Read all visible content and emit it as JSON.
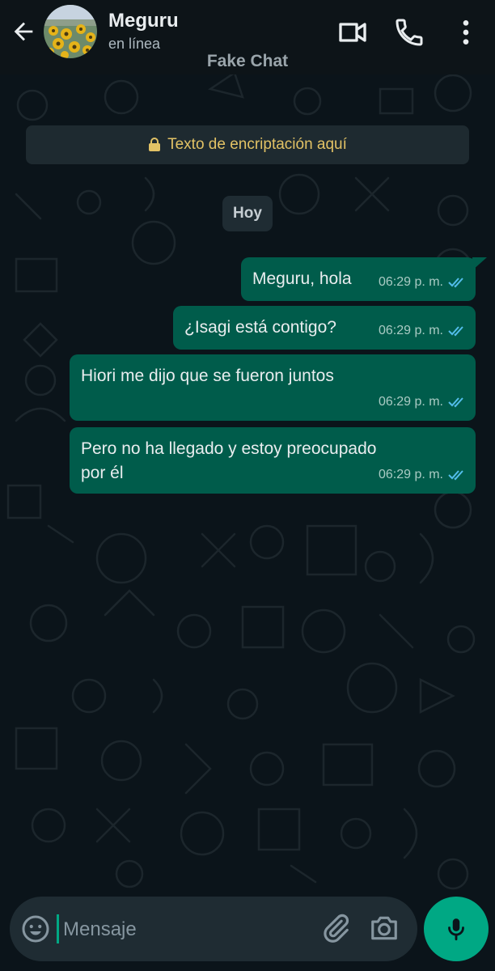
{
  "header": {
    "contact_name": "Meguru",
    "status": "en línea",
    "watermark": "Fake Chat",
    "icons": [
      "arrow-left-icon",
      "video-call-icon",
      "phone-icon",
      "more-vert-icon"
    ]
  },
  "chat": {
    "encryption_notice": "Texto de encriptación aquí",
    "date_label": "Hoy",
    "messages": [
      {
        "text": "Meguru, hola",
        "time": "06:29 p. m.",
        "status": "read"
      },
      {
        "text": "¿Isagi está contigo?",
        "time": "06:29 p. m.",
        "status": "read"
      },
      {
        "text": "Hiori me dijo que se fueron juntos",
        "time": "06:29 p. m.",
        "status": "read"
      },
      {
        "text_line1": "Pero no ha llegado y estoy preocupado",
        "text_line2": "por él",
        "time": "06:29 p. m.",
        "status": "read"
      }
    ]
  },
  "composer": {
    "placeholder": "Mensaje",
    "icons": [
      "emoji-icon",
      "attach-icon",
      "camera-icon",
      "mic-icon"
    ]
  },
  "colors": {
    "header_bg": "#0d1418",
    "chat_bg": "#0b141a",
    "outgoing_bubble": "#005c4b",
    "accent": "#00a884",
    "encryption_text": "#e2c265",
    "read_ticks": "#53bdeb"
  }
}
